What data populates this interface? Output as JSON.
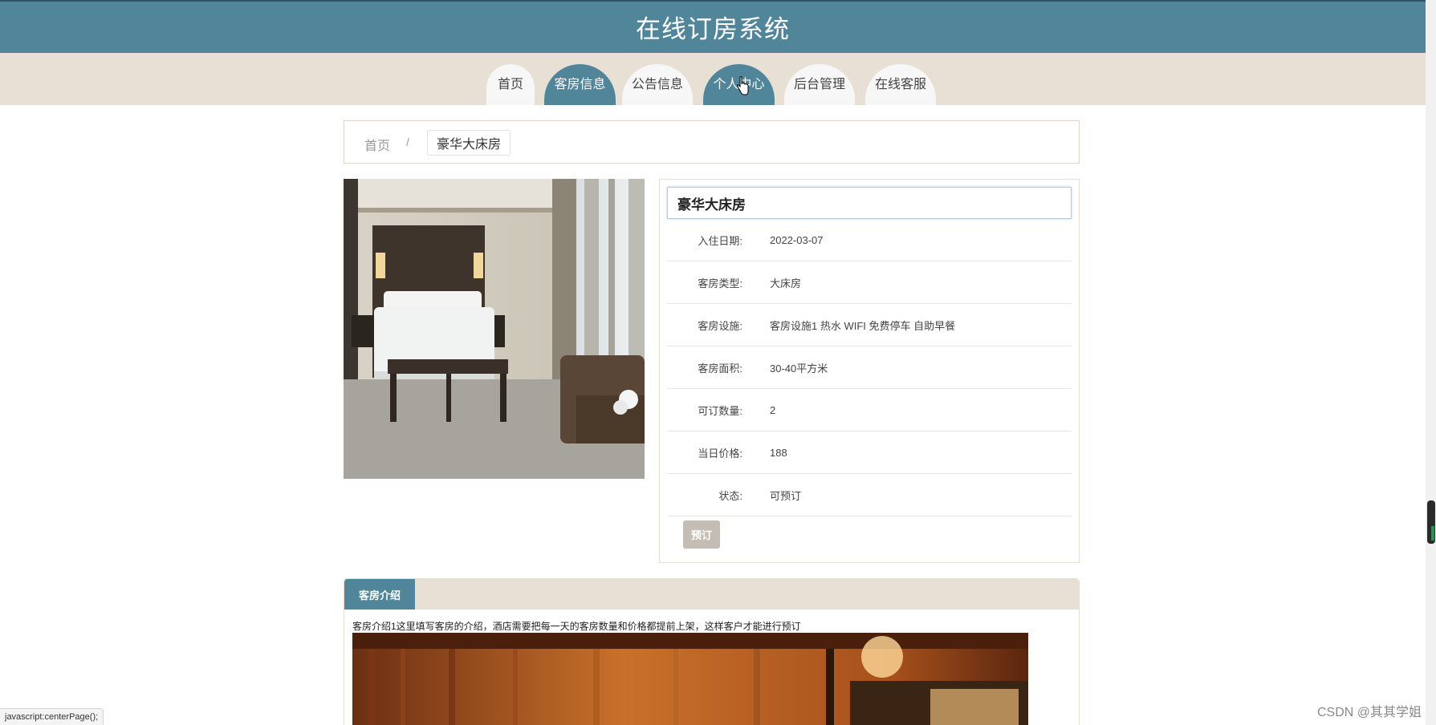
{
  "header": {
    "title": "在线订房系统"
  },
  "nav": {
    "items": [
      {
        "label": "首页",
        "active": false
      },
      {
        "label": "客房信息",
        "active": true
      },
      {
        "label": "公告信息",
        "active": false
      },
      {
        "label": "个人中心",
        "active": true
      },
      {
        "label": "后台管理",
        "active": false
      },
      {
        "label": "在线客服",
        "active": false
      }
    ]
  },
  "breadcrumb": {
    "home": "首页",
    "separator": "/",
    "current": "豪华大床房"
  },
  "room": {
    "title": "豪华大床房",
    "fields": [
      {
        "label": "入住日期:",
        "value": "2022-03-07"
      },
      {
        "label": "客房类型:",
        "value": "大床房"
      },
      {
        "label": "客房设施:",
        "value": "客房设施1 热水 WIFI 免费停车 自助早餐"
      },
      {
        "label": "客房面积:",
        "value": "30-40平方米"
      },
      {
        "label": "可订数量:",
        "value": "2"
      },
      {
        "label": "当日价格:",
        "value": "188"
      },
      {
        "label": "状态:",
        "value": "可预订"
      }
    ],
    "book_label": "预订"
  },
  "intro": {
    "tab_label": "客房介绍",
    "text": "客房介绍1这里填写客房的介绍，酒店需要把每一天的客房数量和价格都提前上架，这样客户才能进行预订"
  },
  "status_bar": {
    "text": "javascript:centerPage();"
  },
  "watermark": {
    "text": "CSDN @其其学姐"
  },
  "colors": {
    "brand": "#51859a",
    "nav_bg": "#e8e0d5",
    "button_disabled": "#c4bdb3"
  }
}
